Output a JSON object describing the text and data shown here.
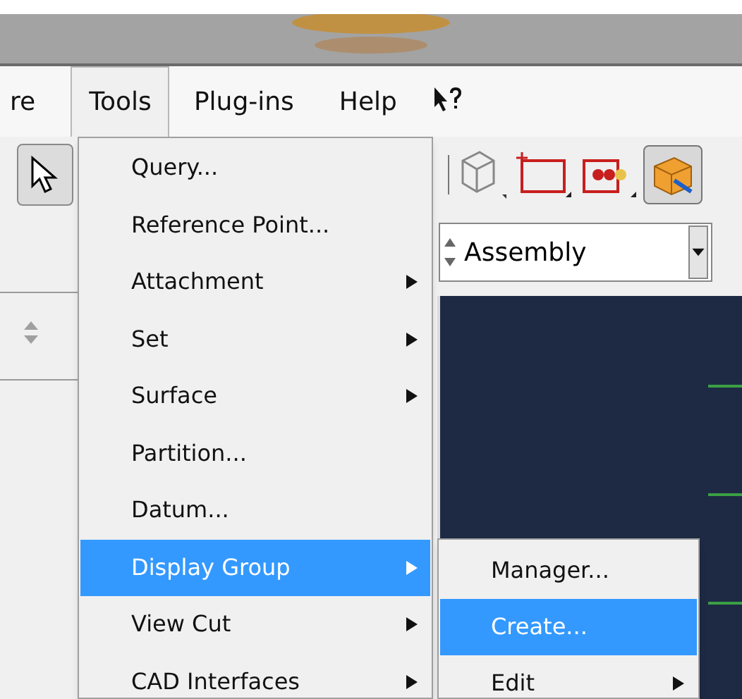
{
  "menu_bar": [
    {
      "label": "re",
      "selected": false
    },
    {
      "label": "Tools",
      "selected": true
    },
    {
      "label": "Plug-ins",
      "selected": false
    },
    {
      "label": "Help",
      "selected": false
    }
  ],
  "tools_menu": [
    {
      "label": "Query...",
      "submenu": false,
      "selected": false
    },
    {
      "label": "Reference Point...",
      "submenu": false,
      "selected": false
    },
    {
      "label": "Attachment",
      "submenu": true,
      "selected": false
    },
    {
      "label": "Set",
      "submenu": true,
      "selected": false
    },
    {
      "label": "Surface",
      "submenu": true,
      "selected": false
    },
    {
      "label": "Partition...",
      "submenu": false,
      "selected": false
    },
    {
      "label": "Datum...",
      "submenu": false,
      "selected": false
    },
    {
      "label": "Display Group",
      "submenu": true,
      "selected": true
    },
    {
      "label": "View Cut",
      "submenu": true,
      "selected": false
    },
    {
      "label": "CAD Interfaces",
      "submenu": true,
      "selected": false
    }
  ],
  "display_group_menu": [
    {
      "label": "Manager...",
      "submenu": false,
      "selected": false
    },
    {
      "label": "Create...",
      "submenu": false,
      "selected": true
    },
    {
      "label": "Edit",
      "submenu": true,
      "selected": false
    }
  ],
  "module_combo": {
    "value": "Assembly"
  }
}
